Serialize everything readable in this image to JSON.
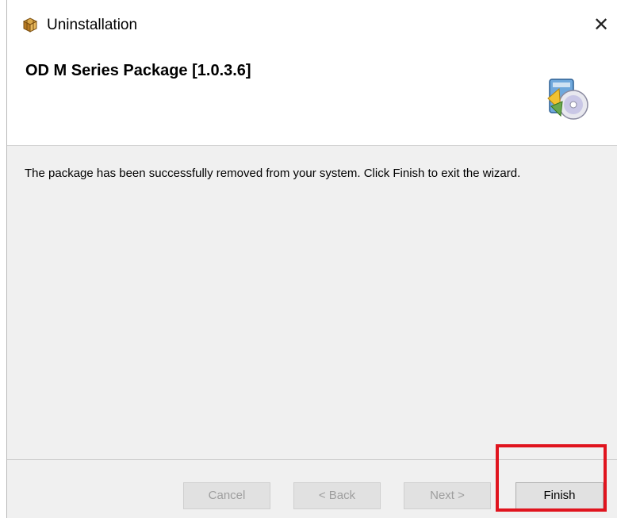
{
  "window": {
    "title": "Uninstallation",
    "close_glyph": "✕",
    "icon": "package-box-icon"
  },
  "header": {
    "package_title": "OD M Series Package [1.0.3.6]",
    "icon": "install-disc-icon"
  },
  "content": {
    "message": "The package has been successfully removed from your system. Click Finish to exit the wizard."
  },
  "buttons": {
    "cancel": "Cancel",
    "back": "< Back",
    "next": "Next >",
    "finish": "Finish"
  },
  "annotation": {
    "highlight_color": "#e0141e",
    "highlight_target": "finish-button"
  }
}
